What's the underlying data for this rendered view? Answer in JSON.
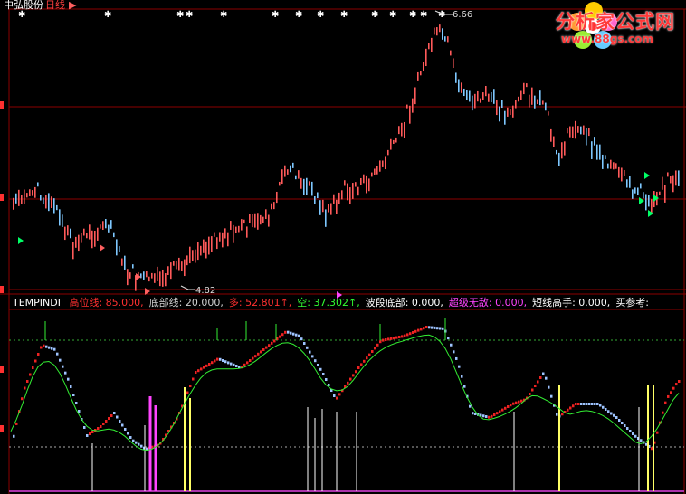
{
  "window": {
    "stock_name": "中弘股份",
    "period": "日线",
    "flag": "▶"
  },
  "price_panel": {
    "high_label": "6.66",
    "low_label": "4.82",
    "buy_marker_color": "#00ff66",
    "sell_marker_color": "#ff6060",
    "grid_color": "#8b0000",
    "up_color": "#ff5a5a",
    "down_color": "#7ec8ff"
  },
  "indicator_panel": {
    "name": "TEMPINDI",
    "fields": [
      {
        "label": "高位线",
        "value": "85.000",
        "color": "#ff3030"
      },
      {
        "label": "底部线",
        "value": "20.000",
        "color": "#cfcfcf"
      },
      {
        "label": "多",
        "value": "52.801↑",
        "color": "#ff3030"
      },
      {
        "label": "空",
        "value": "37.302↑",
        "color": "#33ff33"
      },
      {
        "label": "波段底部",
        "value": "0.000",
        "color": "#ffffff"
      },
      {
        "label": "超级无敌",
        "value": "0.000",
        "color": "#ff44ff"
      },
      {
        "label": "短线高手",
        "value": "0.000",
        "color": "#ffffff"
      },
      {
        "label": "买参考",
        "value": "",
        "color": "#ffffff"
      }
    ]
  },
  "logo": {
    "text": "分析家公式网",
    "url": "www.88gs.com"
  }
}
